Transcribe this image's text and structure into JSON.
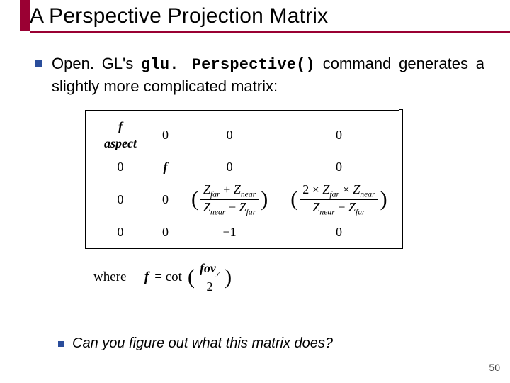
{
  "title": "A Perspective Projection Matrix",
  "bullet": {
    "pre": "Open. GL's ",
    "func": "glu. Perspective()",
    "post": " command generates a slightly more complicated matrix:"
  },
  "matrix": {
    "r0": {
      "c0_num": "f",
      "c0_den": "aspect",
      "c1": "0",
      "c2": "0",
      "c3": "0"
    },
    "r1": {
      "c0": "0",
      "c1": "f",
      "c2": "0",
      "c3": "0"
    },
    "r2": {
      "c0": "0",
      "c1": "0",
      "c2_num_a": "Z",
      "c2_num_a_sub": "far",
      "c2_num_op": " + ",
      "c2_num_b": "Z",
      "c2_num_b_sub": "near",
      "c2_den_a": "Z",
      "c2_den_a_sub": "near",
      "c2_den_op": " − ",
      "c2_den_b": "Z",
      "c2_den_b_sub": "far",
      "c3_num_pre": "2 × ",
      "c3_num_a": "Z",
      "c3_num_a_sub": "far",
      "c3_num_op": " × ",
      "c3_num_b": "Z",
      "c3_num_b_sub": "near",
      "c3_den_a": "Z",
      "c3_den_a_sub": "near",
      "c3_den_op": " − ",
      "c3_den_b": "Z",
      "c3_den_b_sub": "far"
    },
    "r3": {
      "c0": "0",
      "c1": "0",
      "c2": "−1",
      "c3": "0"
    }
  },
  "where": {
    "label": "where",
    "lhs": "f",
    "eq": " = cot",
    "arg_num_a": "fov",
    "arg_num_sub": "y",
    "arg_den": "2"
  },
  "sub_bullet": "Can you figure out what this matrix does?",
  "page_number": "50"
}
